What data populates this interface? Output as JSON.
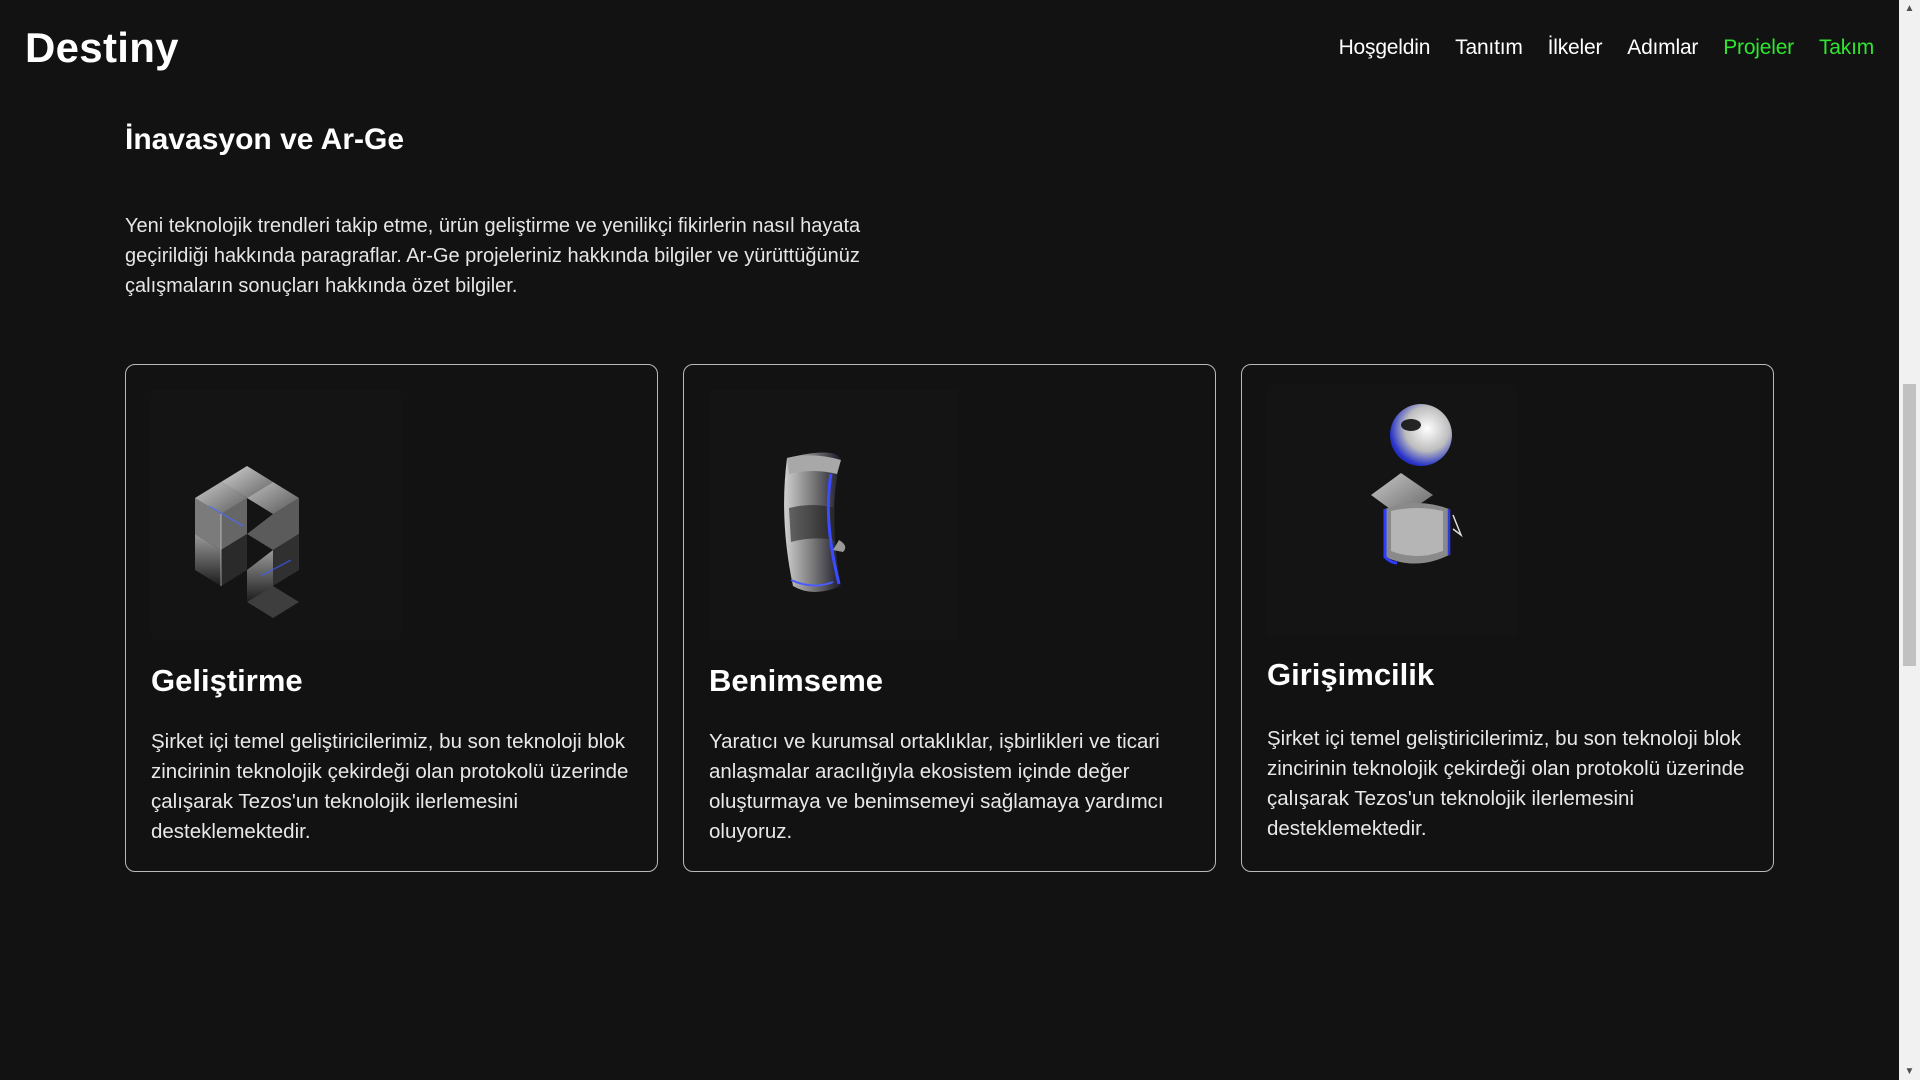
{
  "header": {
    "logo": "Destiny",
    "nav": [
      {
        "label": "Hoşgeldin",
        "color": "#ffffff"
      },
      {
        "label": "Tanıtım",
        "color": "#ffffff"
      },
      {
        "label": "İlkeler",
        "color": "#ffffff"
      },
      {
        "label": "Adımlar",
        "color": "#ffffff"
      },
      {
        "label": "Projeler",
        "color": "#2ee62e"
      },
      {
        "label": "Takım",
        "color": "#2ee62e"
      }
    ]
  },
  "section": {
    "title": "İnavasyon ve Ar-Ge",
    "description": "Yeni teknolojik trendleri takip etme, ürün geliştirme ve yenilikçi fikirlerin nasıl hayata geçirildiği hakkında paragraflar. Ar-Ge projeleriniz hakkında bilgiler ve yürüttüğünüz çalışmaların sonuçları hakkında özet bilgiler."
  },
  "cards": [
    {
      "icon": "glass-cubes-icon",
      "title": "Geliştirme",
      "text": "Şirket içi temel geliştiricilerimiz, bu son teknoloji blok zincirinin teknolojik çekirdeği olan protokolü üzerinde çalışarak Tezos'un teknolojik ilerlemesini desteklemektedir."
    },
    {
      "icon": "glass-arc-icon",
      "title": "Benimseme",
      "text": "Yaratıcı ve kurumsal ortaklıklar, işbirlikleri ve ticari anlaşmalar aracılığıyla ekosistem içinde değer oluşturmaya ve benimsemeyi sağlamaya yardımcı oluyoruz."
    },
    {
      "icon": "glass-shapes-stack-icon",
      "title": "Girişimcilik",
      "text": "Şirket içi temel geliştiricilerimiz, bu son teknoloji blok zincirinin teknolojik çekirdeği olan protokolü üzerinde çalışarak Tezos'un teknolojik ilerlemesini desteklemektedir."
    }
  ],
  "colors": {
    "background": "#131213",
    "accent": "#2ee62e",
    "card_border": "#b9b9b9"
  }
}
